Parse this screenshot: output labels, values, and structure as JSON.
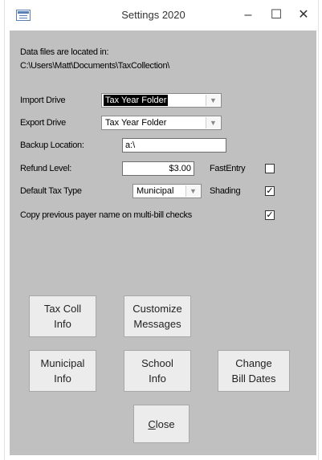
{
  "window": {
    "title": "Settings 2020",
    "minimize_glyph": "–",
    "maximize_glyph": "☐",
    "close_glyph": "✕"
  },
  "info": {
    "line1": "Data files are located in:",
    "line2": "C:\\Users\\Matt\\Documents\\TaxCollection\\"
  },
  "import_drive": {
    "label": "Import Drive",
    "value": "Tax Year Folder"
  },
  "export_drive": {
    "label": "Export Drive",
    "value": "Tax Year Folder"
  },
  "backup_location": {
    "label": "Backup Location:",
    "value": "a:\\"
  },
  "refund_level": {
    "label": "Refund Level:",
    "value": "$3.00"
  },
  "fast_entry": {
    "label": "FastEntry",
    "checked": false
  },
  "default_tax_type": {
    "label": "Default Tax Type",
    "value": "Municipal"
  },
  "shading": {
    "label": "Shading",
    "checked": true,
    "mark": "✓"
  },
  "copy_payer": {
    "label": "Copy previous payer name on multi-bill checks",
    "checked": true,
    "mark": "✓"
  },
  "buttons": {
    "tax_coll_info": "Tax Coll\nInfo",
    "customize_messages": "Customize\nMessages",
    "municipal_info": "Municipal\nInfo",
    "school_info": "School\nInfo",
    "change_bill_dates": "Change\nBill Dates",
    "close_accel": "C",
    "close_rest": "lose"
  },
  "icons": {
    "app": "form-icon",
    "dropdown": "chevron-down-icon"
  },
  "colors": {
    "client_background": "#c0c0c0",
    "button_face": "#ececec",
    "selection": "#000000"
  }
}
